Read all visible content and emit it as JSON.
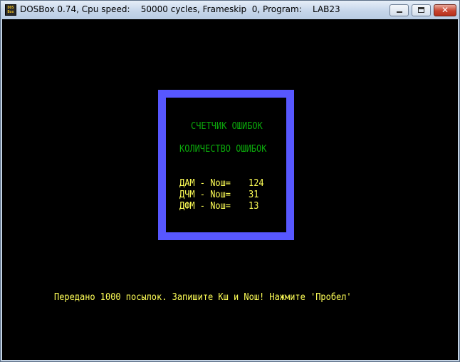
{
  "window": {
    "icon_label": "DOS\nBox",
    "title": "DOSBox 0.74, Cpu speed:    50000 cycles, Frameskip  0, Program:    LAB23"
  },
  "dos_screen": {
    "box_title": "СЧЕТЧИК ОШИБОК",
    "box_subtitle": "КОЛИЧЕСТВО ОШИБОК",
    "rows": [
      {
        "label": "ДАМ - Nош=",
        "value": "124"
      },
      {
        "label": "ДЧМ - Nош=",
        "value": "31"
      },
      {
        "label": "ДФМ - Nош=",
        "value": "13"
      }
    ],
    "message": "Передано 1000 посылок. Запишите Кш и Nош! Нажмите 'Пробел'"
  },
  "colors": {
    "frame": "#5757ff",
    "green_text": "#0ba80b",
    "yellow_text": "#ffff57",
    "background": "#000000"
  }
}
